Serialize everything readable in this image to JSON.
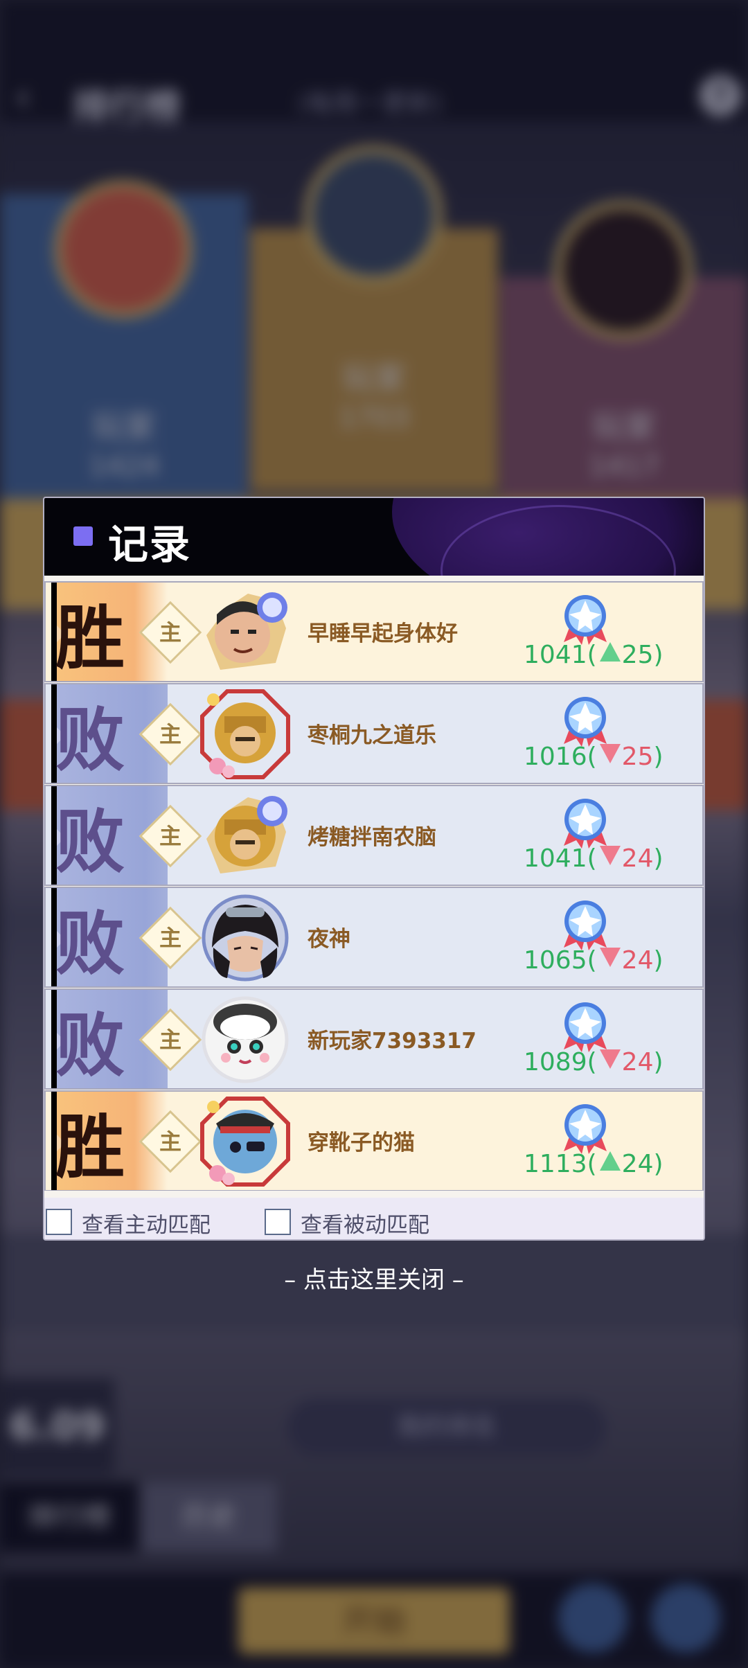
{
  "background": {
    "title": "排行榜",
    "subtitle": "(每周一更新)",
    "podium": [
      {
        "name": "玩家",
        "score": "1424"
      },
      {
        "name": "玩家",
        "score": "1703"
      },
      {
        "name": "玩家",
        "score": "1417"
      }
    ],
    "date": "6.09",
    "pill": "我的排名",
    "tabs": [
      "排行榜",
      "历史"
    ],
    "start_button": "开始"
  },
  "dialog": {
    "title": "记录",
    "main_tag": "主",
    "records": [
      {
        "result": "胜",
        "outcome": "win",
        "name": "早睡早起身体好",
        "score": "1041",
        "delta": "25",
        "direction": "up",
        "avatar": "hero-scholar"
      },
      {
        "result": "败",
        "outcome": "loss",
        "name": "枣桐九之道乐",
        "score": "1016",
        "delta": "25",
        "direction": "down",
        "avatar": "hero-golden-warrior"
      },
      {
        "result": "败",
        "outcome": "loss",
        "name": "烤糖拌南农脑",
        "score": "1041",
        "delta": "24",
        "direction": "down",
        "avatar": "hero-golden-warrior-2"
      },
      {
        "result": "败",
        "outcome": "loss",
        "name": "夜神",
        "score": "1065",
        "delta": "24",
        "direction": "down",
        "avatar": "hero-night"
      },
      {
        "result": "败",
        "outcome": "loss",
        "name": "新玩家7393317",
        "score": "1089",
        "delta": "24",
        "direction": "down",
        "avatar": "hero-panda"
      },
      {
        "result": "胜",
        "outcome": "win",
        "name": "穿靴子的猫",
        "score": "1113",
        "delta": "24",
        "direction": "up",
        "avatar": "hero-cat"
      }
    ],
    "filters": {
      "active_label": "查看主动匹配",
      "passive_label": "查看被动匹配"
    },
    "paren_open": "(",
    "paren_close": ")"
  },
  "close_hint": "– 点击这里关闭 –",
  "colors": {
    "win_bg": "#fdf3dc",
    "loss_bg": "#e3e8f3",
    "score_green": "#2eae5e",
    "delta_red": "#e25868",
    "title_accent": "#7c6ef2"
  }
}
